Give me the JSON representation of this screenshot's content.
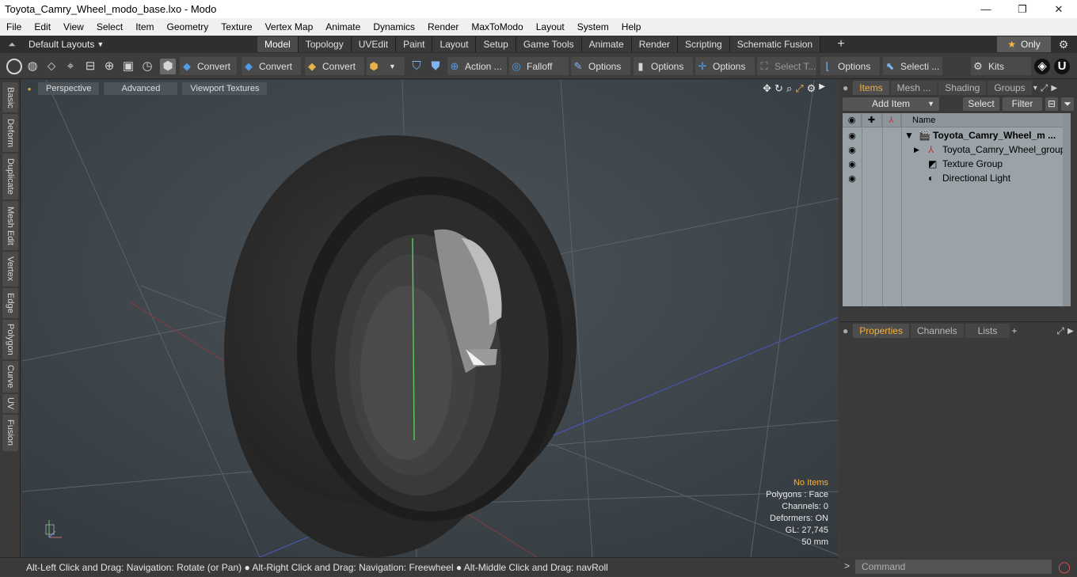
{
  "window": {
    "title": "Toyota_Camry_Wheel_modo_base.lxo - Modo",
    "minimize": "—",
    "maximize": "❐",
    "close": "✕"
  },
  "menu": [
    "File",
    "Edit",
    "View",
    "Select",
    "Item",
    "Geometry",
    "Texture",
    "Vertex Map",
    "Animate",
    "Dynamics",
    "Render",
    "MaxToModo",
    "Layout",
    "System",
    "Help"
  ],
  "layouts": {
    "dropdown": "Default Layouts",
    "tabs": [
      "Model",
      "Topology",
      "UVEdit",
      "Paint",
      "Layout",
      "Setup",
      "Game Tools",
      "Animate",
      "Render",
      "Scripting",
      "Schematic Fusion"
    ],
    "active": "Model",
    "only_label": "Only"
  },
  "toolbar": {
    "convert1": "Convert",
    "convert2": "Convert",
    "convert3": "Convert",
    "action": "Action ...",
    "falloff": "Falloff",
    "options1": "Options",
    "options2": "Options",
    "options3": "Options",
    "select_t": "Select T...",
    "options4": "Options",
    "selecti": "Selecti ...",
    "kits": "Kits"
  },
  "left_tabs": [
    "Basic",
    "Deform",
    "Duplicate",
    "Mesh Edit",
    "Vertex",
    "Edge",
    "Polygon",
    "Curve",
    "UV",
    "Fusion"
  ],
  "viewport": {
    "perspective": "Perspective",
    "advanced": "Advanced",
    "textures": "Viewport Textures",
    "stats": {
      "no_items": "No Items",
      "polygons": "Polygons : Face",
      "channels": "Channels: 0",
      "deformers": "Deformers: ON",
      "gl": "GL: 27,745",
      "mm": "50 mm"
    }
  },
  "items_panel": {
    "tabs": [
      "Items",
      "Mesh ...",
      "Shading",
      "Groups"
    ],
    "active": "Items",
    "add_item": "Add Item",
    "select": "Select",
    "filter": "Filter",
    "name_col": "Name",
    "rows": [
      {
        "label": "Toyota_Camry_Wheel_m ...",
        "bold": true
      },
      {
        "label": "Toyota_Camry_Wheel_group"
      },
      {
        "label": "Texture Group"
      },
      {
        "label": "Directional Light"
      }
    ]
  },
  "properties_panel": {
    "tabs": [
      "Properties",
      "Channels",
      "Lists"
    ],
    "active": "Properties",
    "plus": "+"
  },
  "statusbar": "Alt-Left Click and Drag: Navigation: Rotate (or Pan) ● Alt-Right Click and Drag: Navigation: Freewheel ● Alt-Middle Click and Drag: navRoll",
  "command": {
    "placeholder": "Command"
  }
}
